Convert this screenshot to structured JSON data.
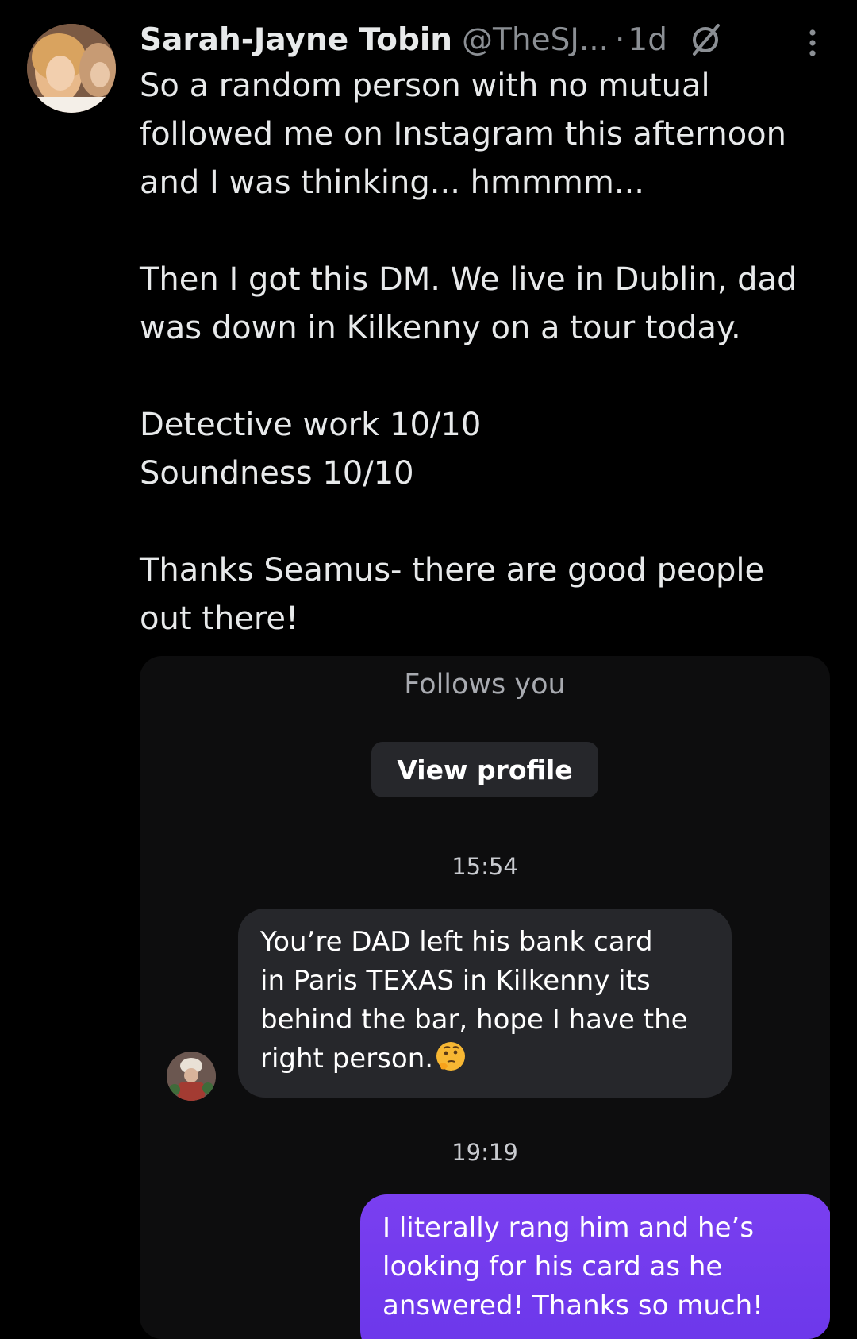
{
  "tweet": {
    "author_name": "Sarah-Jayne Tobin",
    "handle": "@TheSJ...",
    "separator": "·",
    "time": "1d",
    "paragraphs": [
      "So a random person with no mutual\nfollowed me on Instagram this afternoon\nand I was thinking... hmmmm...",
      "Then I got this DM. We live in Dublin, dad\nwas down in Kilkenny  on a tour today.",
      "Detective work 10/10\nSoundness 10/10",
      "Thanks Seamus- there are good people\nout there!"
    ],
    "icons": {
      "avatar": "profile-photo",
      "grok": "grok-icon",
      "more": "more-options-icon"
    }
  },
  "dm_screenshot": {
    "follows_you": "Follows you",
    "view_profile_label": "View profile",
    "timestamps": [
      "15:54",
      "19:19"
    ],
    "incoming_message": "You’re DAD left his bank card\nin Paris TEXAS in Kilkenny its\nbehind the bar, hope I have the\nright person.",
    "incoming_emoji": "thinking-face-emoji",
    "outgoing_message": "I literally rang him and he’s\nlooking for his card as he\nanswered! Thanks so much!",
    "colors": {
      "outgoing_bubble": "#7a3ff0",
      "incoming_bubble": "#26272b",
      "panel_background": "#0d0d0e"
    }
  }
}
